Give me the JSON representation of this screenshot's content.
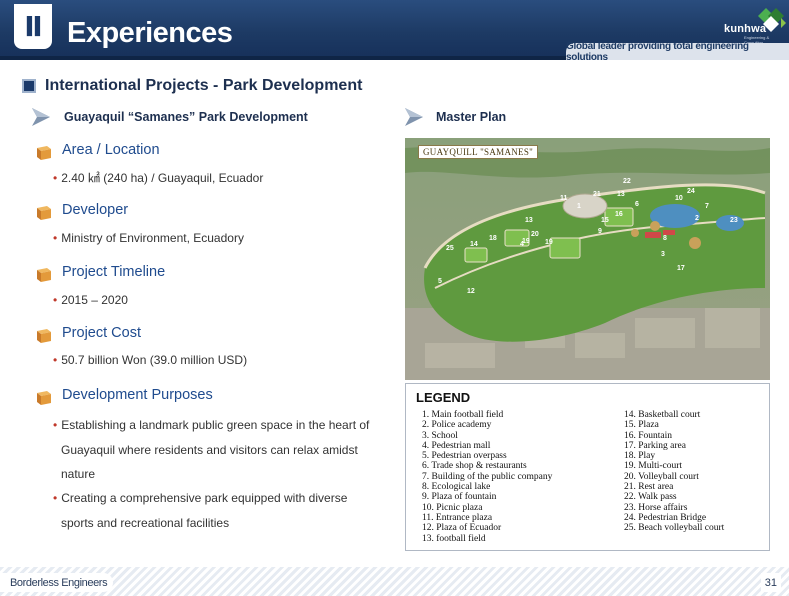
{
  "header": {
    "section_number": "Ⅱ",
    "title": "Experiences",
    "logo_text": "kunhwa",
    "logo_subtext": "Engineering & Consulting",
    "tagline": "Global leader providing total engineering solutions"
  },
  "section": {
    "title": "International Projects - Park Development"
  },
  "left": {
    "heading": "Guayaquil “Samanes” Park Development",
    "blocks": [
      {
        "title": "Area / Location",
        "bullets": [
          "2.40 ㎢ (240 ha) / Guayaquil, Ecuador"
        ]
      },
      {
        "title": "Developer",
        "bullets": [
          "Ministry of Environment, Ecuadory"
        ]
      },
      {
        "title": "Project Timeline",
        "bullets": [
          "2015 – 2020"
        ]
      },
      {
        "title": "Project Cost",
        "bullets": [
          "50.7 billion Won (39.0 million USD)"
        ]
      },
      {
        "title": "Development Purposes",
        "bullets": [
          [
            "Establishing a landmark public green space in the heart of",
            "Guayaquil where residents and visitors can relax amidst",
            "nature"
          ],
          [
            "Creating a comprehensive park equipped with diverse",
            "sports and recreational facilities"
          ]
        ]
      }
    ]
  },
  "right": {
    "heading": "Master Plan",
    "map_label": "GUAYQUILL \"SAMANES\"",
    "map_numbers": [
      "1",
      "2",
      "3",
      "4",
      "5",
      "6",
      "7",
      "8",
      "9",
      "10",
      "11",
      "12",
      "13",
      "14",
      "15",
      "16",
      "17",
      "18",
      "19",
      "20",
      "21",
      "22",
      "23",
      "24",
      "25",
      "13",
      "19"
    ],
    "legend_title": "LEGEND",
    "legend_left": [
      "1.  Main football field",
      "2.  Police academy",
      "3.  School",
      "4.  Pedestrian mall",
      "5.  Pedestrian overpass",
      "6.  Trade shop & restaurants",
      "7.  Building of the public company",
      "8.  Ecological lake",
      "9.  Plaza of fountain",
      "10. Picnic plaza",
      "11. Entrance plaza",
      "12. Plaza of Ecuador",
      "13. football field"
    ],
    "legend_right": [
      "14.  Basketball court",
      "15.  Plaza",
      "16.  Fountain",
      "17.  Parking area",
      "18.  Play",
      "19.  Multi-court",
      "20.  Volleyball court",
      "21.  Rest area",
      "22.  Walk pass",
      "23.  Horse affairs",
      "24.  Pedestrian Bridge",
      "25.  Beach volleyball court"
    ]
  },
  "footer": {
    "label": "Borderless Engineers",
    "page": "31"
  },
  "colors": {
    "header_navy": "#1d3a64",
    "heading_blue": "#1f4b8e",
    "bullet_red": "#c0392b"
  }
}
